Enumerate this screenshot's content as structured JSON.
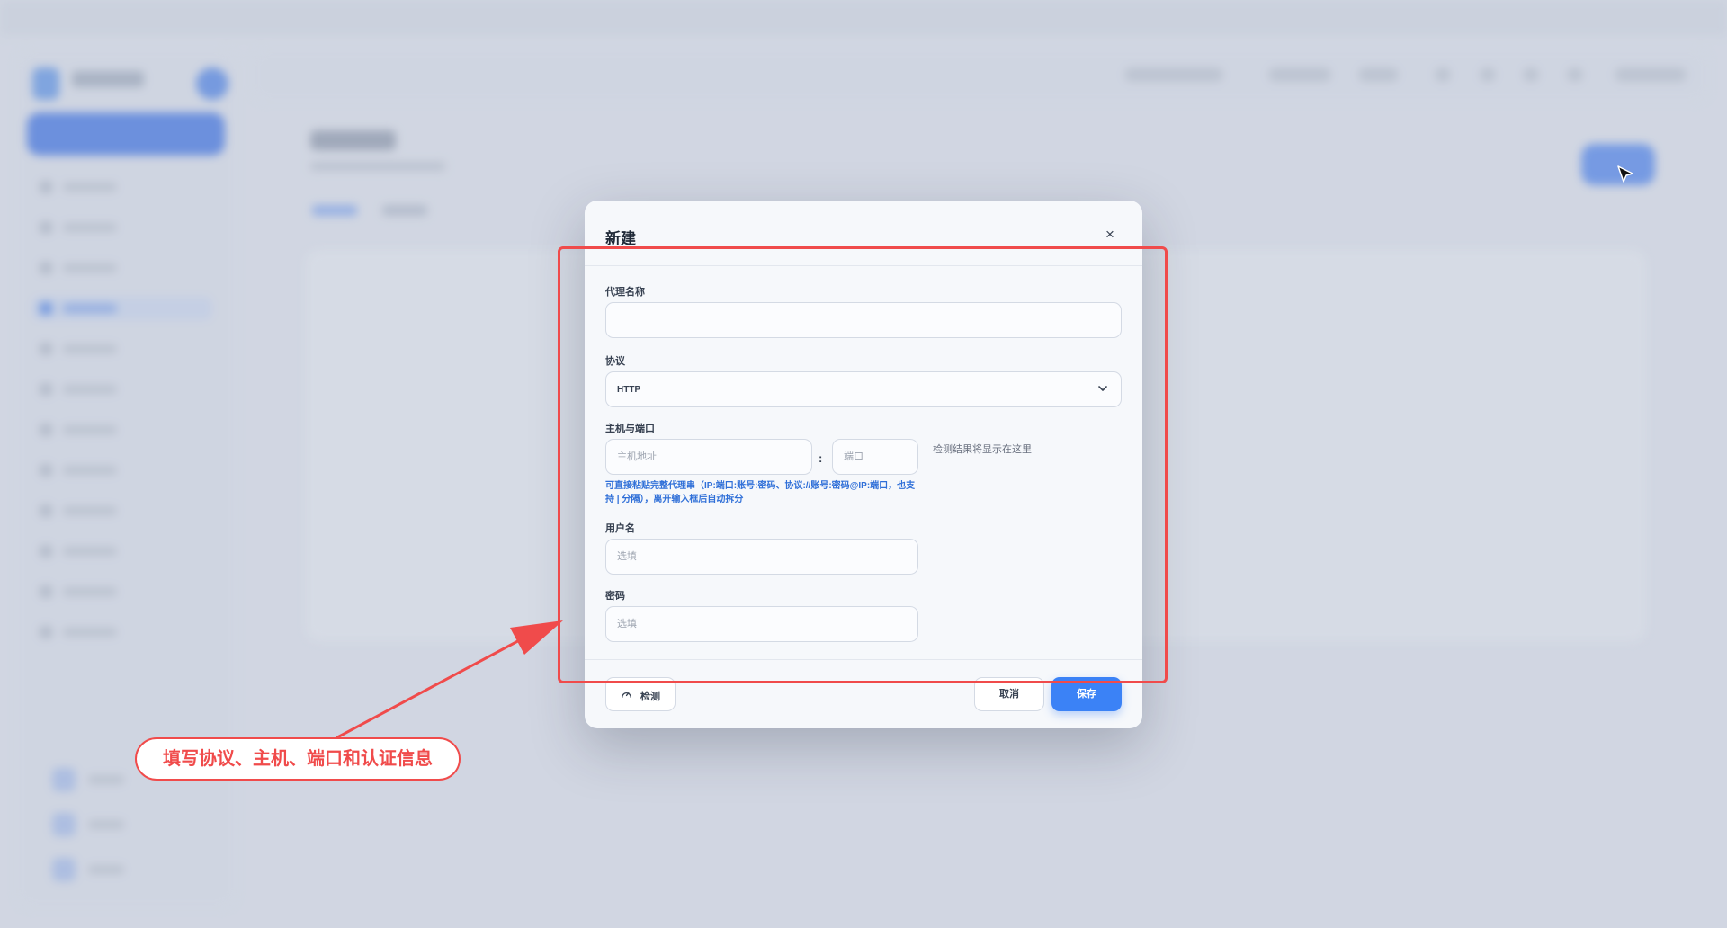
{
  "dialog": {
    "title": "新建",
    "close_symbol": "×",
    "fields": {
      "proxy_name": {
        "label": "代理名称",
        "value": "",
        "placeholder": ""
      },
      "protocol": {
        "label": "协议",
        "selected": "HTTP"
      },
      "host_port": {
        "label": "主机与端口",
        "host_placeholder": "主机地址",
        "separator": ":",
        "port_placeholder": "端口",
        "result_text": "检测结果将显示在这里",
        "hint": "可直接粘贴完整代理串（IP:端口:账号:密码、协议://账号:密码@IP:端口，也支持 | 分隔），离开输入框后自动拆分"
      },
      "username": {
        "label": "用户名",
        "placeholder": "选填"
      },
      "password": {
        "label": "密码",
        "placeholder": "选填"
      }
    },
    "buttons": {
      "check": "检测",
      "cancel": "取消",
      "save": "保存"
    }
  },
  "annotation": {
    "callout": "填写协议、主机、端口和认证信息"
  },
  "colors": {
    "accent": "#3b82f6",
    "annotation": "#f04b4b",
    "hint": "#2f6fd8"
  },
  "icons": [
    "close-icon",
    "chevron-down-icon",
    "gauge-icon",
    "cursor-icon",
    "arrow-icon"
  ]
}
